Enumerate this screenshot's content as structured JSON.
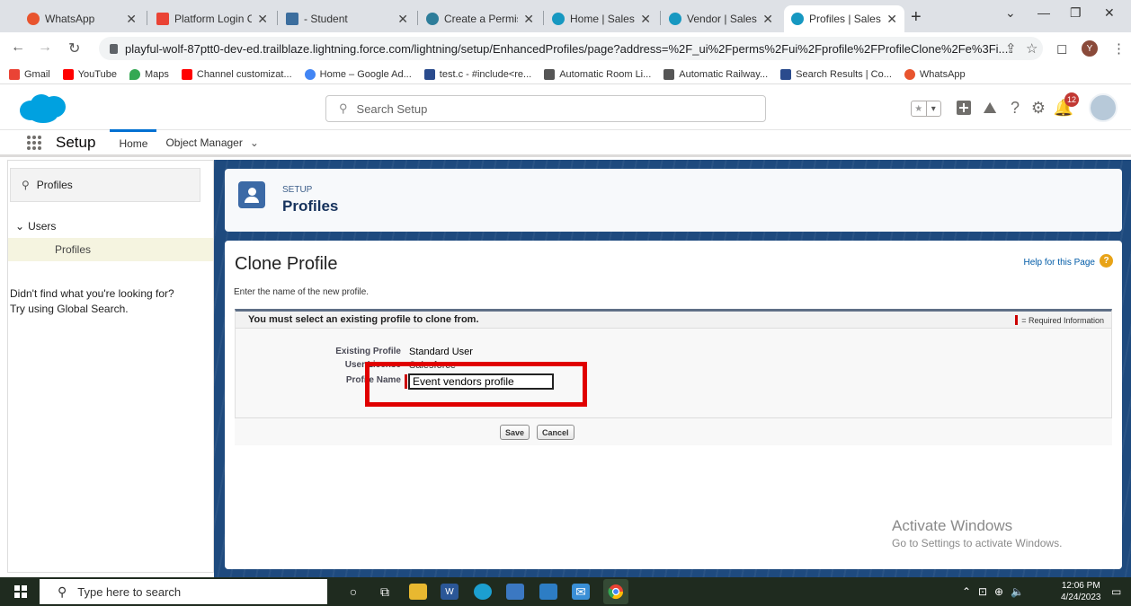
{
  "browser": {
    "tabs": [
      {
        "title": "WhatsApp",
        "icon": "whatsapp-icon",
        "color": "#e8542e"
      },
      {
        "title": "Platform Login C",
        "icon": "gmail-icon",
        "color": "#ea4335"
      },
      {
        "title": "- Student",
        "icon": "student-icon",
        "color": "#3c6e9e"
      },
      {
        "title": "Create a Permissi",
        "icon": "trailhead-icon",
        "color": "#2e7d9a"
      },
      {
        "title": "Home | Salesforc",
        "icon": "salesforce-cloud-icon",
        "color": "#1798c1"
      },
      {
        "title": "Vendor | Salesfor",
        "icon": "salesforce-cloud-icon",
        "color": "#1798c1"
      },
      {
        "title": "Profiles | Salesfor",
        "icon": "salesforce-cloud-icon",
        "color": "#1798c1"
      }
    ],
    "url": "playful-wolf-87ptt0-dev-ed.trailblaze.lightning.force.com/lightning/setup/EnhancedProfiles/page?address=%2F_ui%2Fperms%2Fui%2Fprofile%2FProfileClone%2Fe%3Fi...",
    "profile_initial": "Y",
    "bookmarks": [
      {
        "label": "Gmail",
        "color": "#ea4335"
      },
      {
        "label": "YouTube",
        "color": "#ff0000"
      },
      {
        "label": "Maps",
        "color": "#34a853"
      },
      {
        "label": "Channel customizat...",
        "color": "#ff0000"
      },
      {
        "label": "Home – Google Ad...",
        "color": "#4285f4"
      },
      {
        "label": "test.c - #include<re...",
        "color": "#2a4b8d"
      },
      {
        "label": "Automatic Room Li...",
        "color": "#555555"
      },
      {
        "label": "Automatic Railway...",
        "color": "#555555"
      },
      {
        "label": "Search Results | Co...",
        "color": "#2a4b8d"
      },
      {
        "label": "WhatsApp",
        "color": "#e8542e"
      }
    ]
  },
  "salesforce": {
    "search_placeholder": "Search Setup",
    "notification_count": "12",
    "app_name": "Setup",
    "nav_tabs": [
      "Home",
      "Object Manager"
    ],
    "sidebar": {
      "quick_find": "Profiles",
      "tree_parent": "Users",
      "tree_child": "Profiles",
      "help_line1": "Didn't find what you're looking for?",
      "help_line2": "Try using Global Search."
    },
    "page_header": {
      "kicker": "SETUP",
      "title": "Profiles"
    },
    "clone": {
      "title": "Clone Profile",
      "help_link": "Help for this Page",
      "instruction": "Enter the name of the new profile.",
      "block_message": "You must select an existing profile to clone from.",
      "required_legend": "= Required Information",
      "fields": {
        "existing_profile_label": "Existing Profile",
        "existing_profile_value": "Standard User",
        "user_license_label": "User License",
        "user_license_value": "Salesforce",
        "profile_name_label": "Profile Name",
        "profile_name_value": "Event vendors profile"
      },
      "save_label": "Save",
      "cancel_label": "Cancel"
    }
  },
  "watermark": {
    "line1": "Activate Windows",
    "line2": "Go to Settings to activate Windows."
  },
  "taskbar": {
    "search_placeholder": "Type here to search",
    "time": "12:06 PM",
    "date": "4/24/2023"
  }
}
